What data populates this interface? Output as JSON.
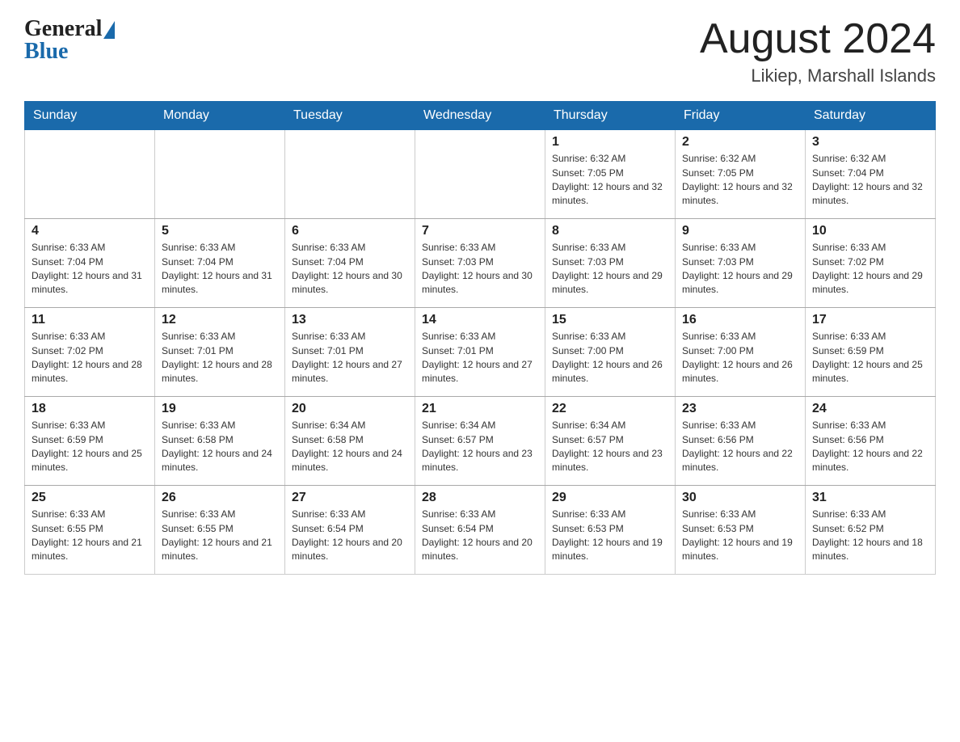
{
  "header": {
    "logo_general": "General",
    "logo_blue": "Blue",
    "month_title": "August 2024",
    "location": "Likiep, Marshall Islands"
  },
  "days_of_week": [
    "Sunday",
    "Monday",
    "Tuesday",
    "Wednesday",
    "Thursday",
    "Friday",
    "Saturday"
  ],
  "weeks": [
    [
      {
        "day": "",
        "sunrise": "",
        "sunset": "",
        "daylight": ""
      },
      {
        "day": "",
        "sunrise": "",
        "sunset": "",
        "daylight": ""
      },
      {
        "day": "",
        "sunrise": "",
        "sunset": "",
        "daylight": ""
      },
      {
        "day": "",
        "sunrise": "",
        "sunset": "",
        "daylight": ""
      },
      {
        "day": "1",
        "sunrise": "Sunrise: 6:32 AM",
        "sunset": "Sunset: 7:05 PM",
        "daylight": "Daylight: 12 hours and 32 minutes."
      },
      {
        "day": "2",
        "sunrise": "Sunrise: 6:32 AM",
        "sunset": "Sunset: 7:05 PM",
        "daylight": "Daylight: 12 hours and 32 minutes."
      },
      {
        "day": "3",
        "sunrise": "Sunrise: 6:32 AM",
        "sunset": "Sunset: 7:04 PM",
        "daylight": "Daylight: 12 hours and 32 minutes."
      }
    ],
    [
      {
        "day": "4",
        "sunrise": "Sunrise: 6:33 AM",
        "sunset": "Sunset: 7:04 PM",
        "daylight": "Daylight: 12 hours and 31 minutes."
      },
      {
        "day": "5",
        "sunrise": "Sunrise: 6:33 AM",
        "sunset": "Sunset: 7:04 PM",
        "daylight": "Daylight: 12 hours and 31 minutes."
      },
      {
        "day": "6",
        "sunrise": "Sunrise: 6:33 AM",
        "sunset": "Sunset: 7:04 PM",
        "daylight": "Daylight: 12 hours and 30 minutes."
      },
      {
        "day": "7",
        "sunrise": "Sunrise: 6:33 AM",
        "sunset": "Sunset: 7:03 PM",
        "daylight": "Daylight: 12 hours and 30 minutes."
      },
      {
        "day": "8",
        "sunrise": "Sunrise: 6:33 AM",
        "sunset": "Sunset: 7:03 PM",
        "daylight": "Daylight: 12 hours and 29 minutes."
      },
      {
        "day": "9",
        "sunrise": "Sunrise: 6:33 AM",
        "sunset": "Sunset: 7:03 PM",
        "daylight": "Daylight: 12 hours and 29 minutes."
      },
      {
        "day": "10",
        "sunrise": "Sunrise: 6:33 AM",
        "sunset": "Sunset: 7:02 PM",
        "daylight": "Daylight: 12 hours and 29 minutes."
      }
    ],
    [
      {
        "day": "11",
        "sunrise": "Sunrise: 6:33 AM",
        "sunset": "Sunset: 7:02 PM",
        "daylight": "Daylight: 12 hours and 28 minutes."
      },
      {
        "day": "12",
        "sunrise": "Sunrise: 6:33 AM",
        "sunset": "Sunset: 7:01 PM",
        "daylight": "Daylight: 12 hours and 28 minutes."
      },
      {
        "day": "13",
        "sunrise": "Sunrise: 6:33 AM",
        "sunset": "Sunset: 7:01 PM",
        "daylight": "Daylight: 12 hours and 27 minutes."
      },
      {
        "day": "14",
        "sunrise": "Sunrise: 6:33 AM",
        "sunset": "Sunset: 7:01 PM",
        "daylight": "Daylight: 12 hours and 27 minutes."
      },
      {
        "day": "15",
        "sunrise": "Sunrise: 6:33 AM",
        "sunset": "Sunset: 7:00 PM",
        "daylight": "Daylight: 12 hours and 26 minutes."
      },
      {
        "day": "16",
        "sunrise": "Sunrise: 6:33 AM",
        "sunset": "Sunset: 7:00 PM",
        "daylight": "Daylight: 12 hours and 26 minutes."
      },
      {
        "day": "17",
        "sunrise": "Sunrise: 6:33 AM",
        "sunset": "Sunset: 6:59 PM",
        "daylight": "Daylight: 12 hours and 25 minutes."
      }
    ],
    [
      {
        "day": "18",
        "sunrise": "Sunrise: 6:33 AM",
        "sunset": "Sunset: 6:59 PM",
        "daylight": "Daylight: 12 hours and 25 minutes."
      },
      {
        "day": "19",
        "sunrise": "Sunrise: 6:33 AM",
        "sunset": "Sunset: 6:58 PM",
        "daylight": "Daylight: 12 hours and 24 minutes."
      },
      {
        "day": "20",
        "sunrise": "Sunrise: 6:34 AM",
        "sunset": "Sunset: 6:58 PM",
        "daylight": "Daylight: 12 hours and 24 minutes."
      },
      {
        "day": "21",
        "sunrise": "Sunrise: 6:34 AM",
        "sunset": "Sunset: 6:57 PM",
        "daylight": "Daylight: 12 hours and 23 minutes."
      },
      {
        "day": "22",
        "sunrise": "Sunrise: 6:34 AM",
        "sunset": "Sunset: 6:57 PM",
        "daylight": "Daylight: 12 hours and 23 minutes."
      },
      {
        "day": "23",
        "sunrise": "Sunrise: 6:33 AM",
        "sunset": "Sunset: 6:56 PM",
        "daylight": "Daylight: 12 hours and 22 minutes."
      },
      {
        "day": "24",
        "sunrise": "Sunrise: 6:33 AM",
        "sunset": "Sunset: 6:56 PM",
        "daylight": "Daylight: 12 hours and 22 minutes."
      }
    ],
    [
      {
        "day": "25",
        "sunrise": "Sunrise: 6:33 AM",
        "sunset": "Sunset: 6:55 PM",
        "daylight": "Daylight: 12 hours and 21 minutes."
      },
      {
        "day": "26",
        "sunrise": "Sunrise: 6:33 AM",
        "sunset": "Sunset: 6:55 PM",
        "daylight": "Daylight: 12 hours and 21 minutes."
      },
      {
        "day": "27",
        "sunrise": "Sunrise: 6:33 AM",
        "sunset": "Sunset: 6:54 PM",
        "daylight": "Daylight: 12 hours and 20 minutes."
      },
      {
        "day": "28",
        "sunrise": "Sunrise: 6:33 AM",
        "sunset": "Sunset: 6:54 PM",
        "daylight": "Daylight: 12 hours and 20 minutes."
      },
      {
        "day": "29",
        "sunrise": "Sunrise: 6:33 AM",
        "sunset": "Sunset: 6:53 PM",
        "daylight": "Daylight: 12 hours and 19 minutes."
      },
      {
        "day": "30",
        "sunrise": "Sunrise: 6:33 AM",
        "sunset": "Sunset: 6:53 PM",
        "daylight": "Daylight: 12 hours and 19 minutes."
      },
      {
        "day": "31",
        "sunrise": "Sunrise: 6:33 AM",
        "sunset": "Sunset: 6:52 PM",
        "daylight": "Daylight: 12 hours and 18 minutes."
      }
    ]
  ]
}
